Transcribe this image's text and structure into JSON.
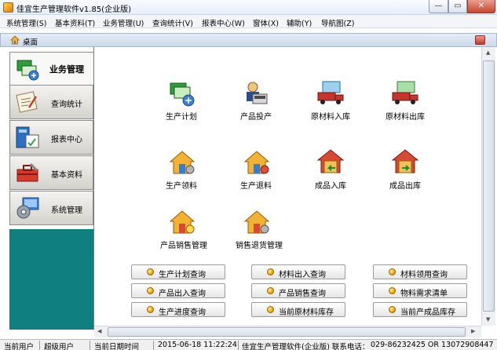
{
  "window": {
    "title": "佳宜生产管理软件v1.85(企业版)",
    "min_label": "—",
    "max_label": "▭",
    "close_label": "✕"
  },
  "menu": [
    "系统管理(S)",
    "基本资料(T)",
    "业务管理(U)",
    "查询统计(V)",
    "报表中心(W)",
    "窗体(X)",
    "辅助(Y)",
    "导航图(Z)"
  ],
  "inner_window": {
    "title": "桌面"
  },
  "nav": [
    {
      "label": "业务管理",
      "icon": "business-icon",
      "active": true
    },
    {
      "label": "查询统计",
      "icon": "query-icon",
      "active": false
    },
    {
      "label": "报表中心",
      "icon": "report-icon",
      "active": false
    },
    {
      "label": "基本资料",
      "icon": "toolbox-icon",
      "active": false
    },
    {
      "label": "系统管理",
      "icon": "settings-icon",
      "active": false
    }
  ],
  "modules": [
    {
      "label": "生产计划",
      "icon": "production-plan-icon"
    },
    {
      "label": "产品投产",
      "icon": "product-launch-icon"
    },
    {
      "label": "原材料入库",
      "icon": "truck-in-icon"
    },
    {
      "label": "原材料出库",
      "icon": "truck-out-icon"
    },
    {
      "label": "生产领料",
      "icon": "house-in-icon"
    },
    {
      "label": "生产退料",
      "icon": "house-return-icon"
    },
    {
      "label": "成品入库",
      "icon": "warehouse-in-icon"
    },
    {
      "label": "成品出库",
      "icon": "warehouse-out-icon"
    },
    {
      "label": "产品销售管理",
      "icon": "sales-icon"
    },
    {
      "label": "销售退货管理",
      "icon": "sales-return-icon"
    }
  ],
  "query_buttons": [
    "生产计划查询",
    "材料出入查询",
    "材料领用查询",
    "产品出入查询",
    "产品销售查询",
    "物料需求清单",
    "生产进度查询",
    "当前原材料库存",
    "当前产成品库存"
  ],
  "status": {
    "user_label": "当前用户",
    "user_value": "超级用户",
    "date_label": "当前日期时间",
    "date_value": "2015-06-18 11:22:24",
    "company": "佳宜生产管理软件(企业版) 联系电话：",
    "phone": "029-86232425 OR 13072908447"
  },
  "colors": {
    "nav_fill": "#107f7f",
    "accent": "#f0a800"
  }
}
